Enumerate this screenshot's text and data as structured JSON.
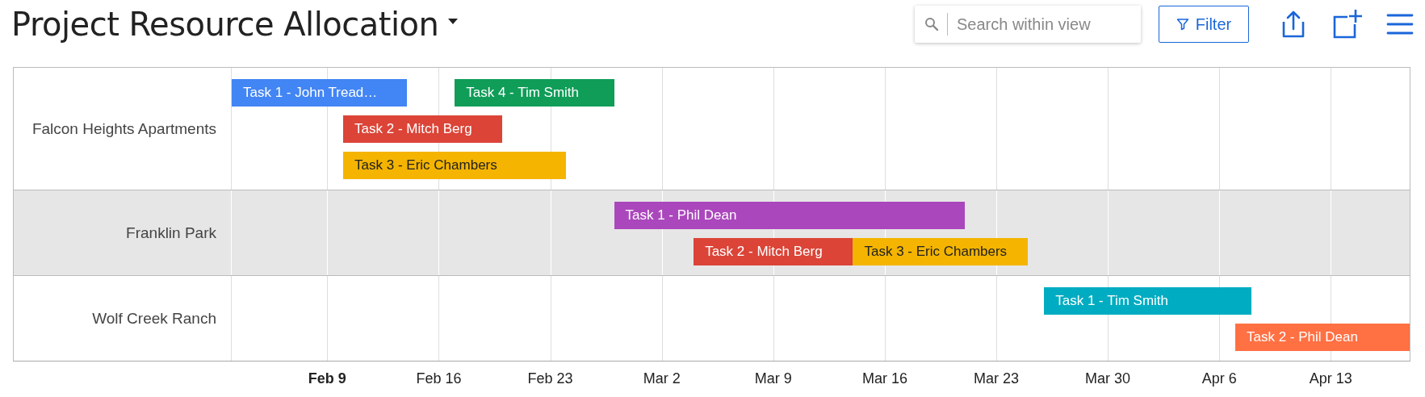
{
  "title": "Project Resource Allocation",
  "search": {
    "placeholder": "Search within view"
  },
  "filter_button": "Filter",
  "rows": [
    {
      "label": "Falcon Heights Apartments",
      "shaded": false,
      "bars": [
        {
          "label": "Task 1 - John Tread…",
          "color": "#4285f4"
        },
        {
          "label": "Task 4 - Tim Smith",
          "color": "#0f9d58"
        },
        {
          "label": "Task 2 - Mitch Berg",
          "color": "#db4437"
        },
        {
          "label": "Task 3 - Eric Chambers",
          "color": "#f4b400"
        }
      ]
    },
    {
      "label": "Franklin Park",
      "shaded": true,
      "bars": [
        {
          "label": "Task 1 - Phil Dean",
          "color": "#ab47bc"
        },
        {
          "label": "Task 2 - Mitch Berg",
          "color": "#db4437"
        },
        {
          "label": "Task 3 - Eric Chambers",
          "color": "#f4b400"
        }
      ]
    },
    {
      "label": "Wolf Creek Ranch",
      "shaded": false,
      "bars": [
        {
          "label": "Task 1 - Tim Smith",
          "color": "#00acc1"
        },
        {
          "label": "Task 2 - Phil Dean",
          "color": "#ff7043"
        }
      ]
    }
  ],
  "axis": [
    {
      "label": "Feb 9",
      "current": true
    },
    {
      "label": "Feb 16",
      "current": false
    },
    {
      "label": "Feb 23",
      "current": false
    },
    {
      "label": "Mar 2",
      "current": false
    },
    {
      "label": "Mar 9",
      "current": false
    },
    {
      "label": "Mar 16",
      "current": false
    },
    {
      "label": "Mar 23",
      "current": false
    },
    {
      "label": "Mar 30",
      "current": false
    },
    {
      "label": "Apr 6",
      "current": false
    },
    {
      "label": "Apr 13",
      "current": false
    }
  ]
}
